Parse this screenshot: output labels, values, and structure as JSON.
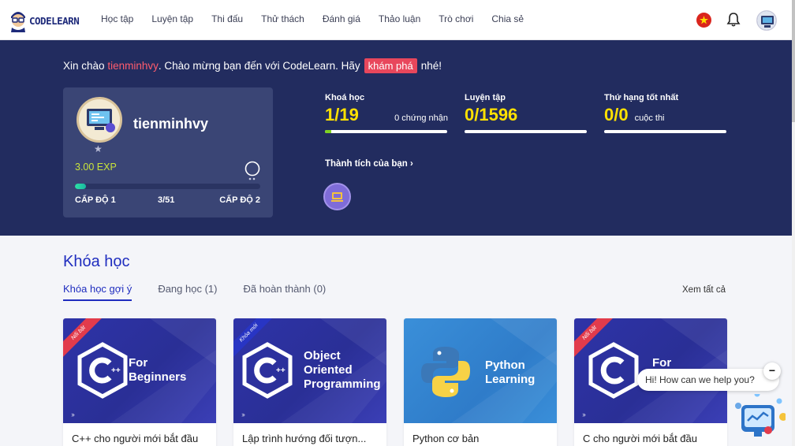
{
  "nav": {
    "logo_text": "CODELEARN",
    "items": [
      "Học tập",
      "Luyện tập",
      "Thi đấu",
      "Thử thách",
      "Đánh giá",
      "Thảo luận",
      "Trò chơi",
      "Chia sẻ"
    ]
  },
  "hero": {
    "greeting_prefix": "Xin chào",
    "username": "tienminhvy",
    "greeting_mid": ". Chào mừng bạn đến với CodeLearn. Hãy",
    "explore_label": "khám phá",
    "greeting_suffix": "nhé!"
  },
  "profile": {
    "name": "tienminhvy",
    "exp": "3.00 EXP",
    "level_progress": 0.06,
    "level_current": "CẤP ĐỘ 1",
    "level_count": "3/51",
    "level_next": "CẤP ĐỘ 2"
  },
  "stats": [
    {
      "label": "Khoá học",
      "value": "1/19",
      "sub": "0 chứng nhận",
      "progress": 0.053
    },
    {
      "label": "Luyện tập",
      "value": "0/1596",
      "sub": "",
      "progress": 0
    },
    {
      "label": "Thứ hạng tốt nhất",
      "value": "0/0",
      "sub": "cuộc thi",
      "progress": 0
    }
  ],
  "achievements_link": "Thành tích của bạn",
  "courses": {
    "title": "Khóa học",
    "tabs": [
      "Khóa học gợi ý",
      "Đang học (1)",
      "Đã hoàn thành (0)"
    ],
    "see_all": "Xem tất cả",
    "cards": [
      {
        "title": "C++ cho người mới bắt đầu",
        "ribbon": "Nổi bật",
        "caption": [
          "For",
          "Beginners"
        ],
        "icon": "cpp-hexagon-icon"
      },
      {
        "title": "Lập trình hướng đối tượn...",
        "ribbon": "Khóa mới",
        "caption": [
          "Object",
          "Oriented",
          "Programming"
        ],
        "icon": "cpp-hexagon-icon"
      },
      {
        "title": "Python cơ bản",
        "ribbon": "",
        "caption": [
          "Python",
          "Learning"
        ],
        "icon": "python-logo-icon"
      },
      {
        "title": "C cho người mới bắt đầu",
        "ribbon": "Nổi bật",
        "caption": [
          "For"
        ],
        "icon": "c-hexagon-icon"
      }
    ]
  },
  "chat": {
    "prompt": "Hi! How can we help you?",
    "close": "−"
  },
  "colors": {
    "hero_bg": "#222c5f",
    "accent_blue": "#1f2dbf",
    "stat_yellow": "#ffe100",
    "exp_green": "#c9e43a",
    "explore_red": "#e8475c"
  }
}
